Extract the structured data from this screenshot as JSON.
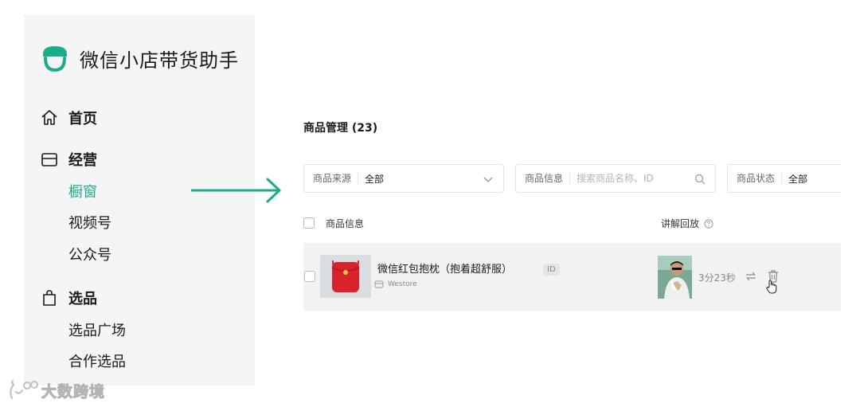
{
  "app": {
    "name": "微信小店带货助手"
  },
  "sidebar": {
    "home": "首页",
    "business": {
      "label": "经营",
      "items": [
        "橱窗",
        "视频号",
        "公众号"
      ],
      "active_index": 0
    },
    "selection": {
      "label": "选品",
      "items": [
        "选品广场",
        "合作选品"
      ]
    }
  },
  "main": {
    "title": "商品管理",
    "count": "(23)",
    "filters": {
      "source": {
        "label": "商品来源",
        "value": "全部"
      },
      "info": {
        "label": "商品信息",
        "placeholder": "搜索商品名称、ID"
      },
      "status": {
        "label": "商品状态",
        "value": "全部"
      }
    },
    "table": {
      "headers": {
        "product": "商品信息",
        "replay": "讲解回放"
      },
      "rows": [
        {
          "name": "微信红包抱枕（抱着超舒服）",
          "store": "Westore",
          "id_badge": "ID",
          "duration": "3分23秒"
        }
      ]
    }
  },
  "watermark": "大数跨境",
  "colors": {
    "accent": "#1aad8c",
    "sidebar_bg": "#f5f5f5",
    "row_bg": "#f2f2f2"
  },
  "icons": [
    "shop-logo-icon",
    "home-icon",
    "storefront-icon",
    "shopping-bag-icon",
    "chevron-down-icon",
    "search-icon",
    "help-circle-icon",
    "store-icon",
    "swap-icon",
    "trash-icon",
    "hand-cursor-icon",
    "arrow-right-icon"
  ]
}
